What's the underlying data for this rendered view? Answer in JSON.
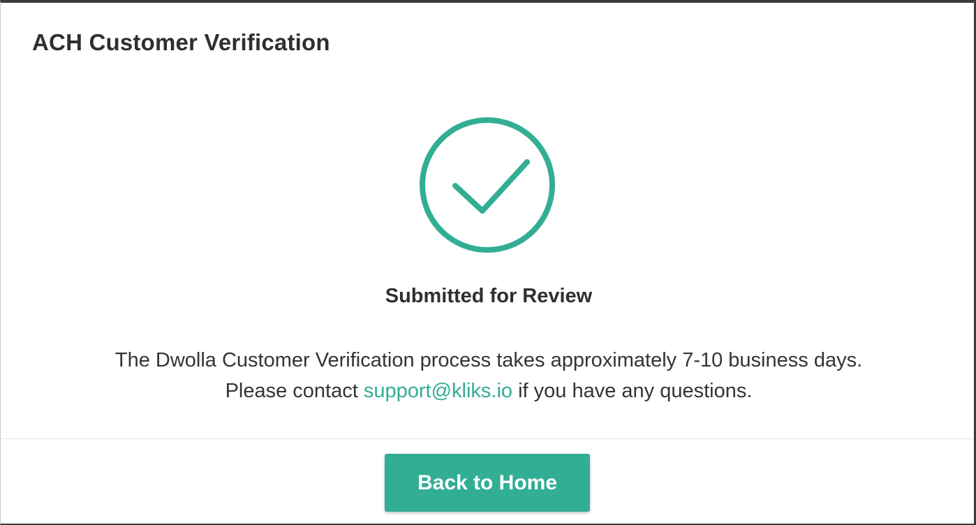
{
  "modal": {
    "title": "ACH Customer Verification"
  },
  "status": {
    "icon": "check-circle-icon",
    "heading": "Submitted for Review"
  },
  "message": {
    "line1": "The Dwolla Customer Verification process takes approximately 7-10 business days.",
    "line2_prefix": "Please contact ",
    "support_email": "support@kliks.io",
    "line2_suffix": " if you have any questions."
  },
  "footer": {
    "back_button_label": "Back to Home"
  },
  "colors": {
    "accent": "#32ae94",
    "text": "#2e2f31",
    "background": "#ffffff"
  }
}
